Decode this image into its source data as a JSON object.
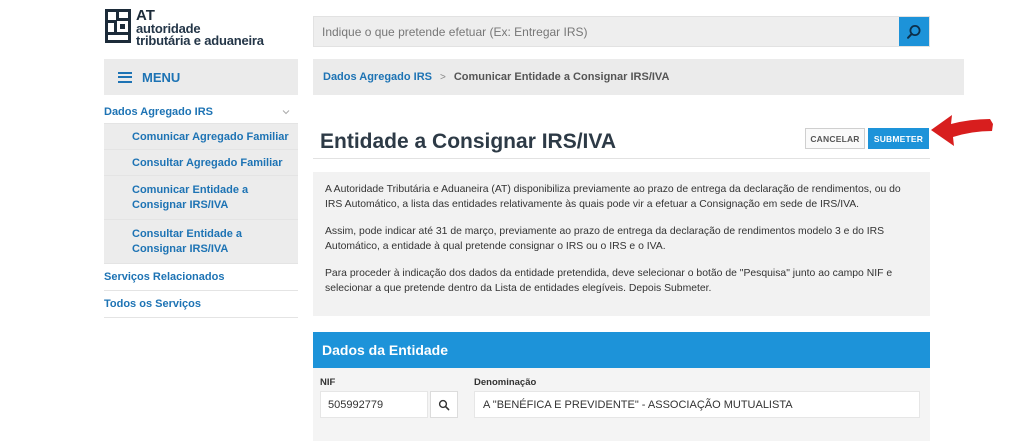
{
  "logo": {
    "line1": "AT",
    "line2": "autoridade",
    "line3": "tributária e aduaneira"
  },
  "search": {
    "placeholder": "Indique o que pretende efetuar (Ex: Entregar IRS)",
    "icon": "search-icon"
  },
  "menu": {
    "label": "MENU",
    "icon": "hamburger-icon"
  },
  "breadcrumb": {
    "parent": "Dados Agregado IRS",
    "separator": ">",
    "current": "Comunicar Entidade a Consignar IRS/IVA"
  },
  "sidebar": {
    "section": {
      "label": "Dados Agregado IRS",
      "icon": "chevron-down-icon"
    },
    "subitems": [
      {
        "label": "Comunicar Agregado Familiar"
      },
      {
        "label": "Consultar Agregado Familiar"
      },
      {
        "label_l1": "Comunicar Entidade a",
        "label_l2": "Consignar IRS/IVA"
      },
      {
        "label_l1": "Consultar Entidade a",
        "label_l2": "Consignar IRS/IVA"
      }
    ],
    "items": [
      {
        "label": "Serviços Relacionados"
      },
      {
        "label": "Todos os Serviços"
      }
    ]
  },
  "page": {
    "title": "Entidade a Consignar IRS/IVA",
    "cancel_label": "CANCELAR",
    "submit_label": "SUBMETER"
  },
  "info": {
    "p1": "A Autoridade Tributária e Aduaneira (AT) disponibiliza previamente ao prazo de entrega da declaração de rendimentos, ou do IRS Automático, a lista das entidades relativamente às quais pode vir a efetuar a Consignação em sede de IRS/IVA.",
    "p2": "Assim, pode indicar até 31 de março, previamente ao prazo de entrega da declaração de rendimentos modelo 3 e do IRS Automático, a entidade à qual pretende consignar o IRS ou o IRS e o IVA.",
    "p3": "Para proceder à indicação dos dados da entidade pretendida, deve selecionar o botão de \"Pesquisa\" junto ao campo NIF e selecionar a que pretende dentro da Lista de entidades elegíveis. Depois Submeter."
  },
  "entity": {
    "header": "Dados da Entidade",
    "nif_label": "NIF",
    "nif_value": "505992779",
    "denominacao_label": "Denominação",
    "denominacao_value": "A \"BENÉFICA E PREVIDENTE\" - ASSOCIAÇÃO MUTUALISTA"
  },
  "colors": {
    "accent": "#1d93d9",
    "link": "#1d73b4",
    "arrow": "#d81e1e"
  }
}
